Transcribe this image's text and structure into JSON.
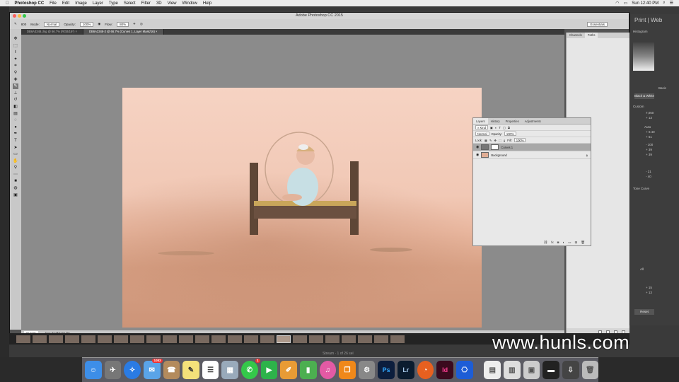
{
  "menubar": {
    "brand": "Photoshop CC",
    "items": [
      "File",
      "Edit",
      "Image",
      "Layer",
      "Type",
      "Select",
      "Filter",
      "3D",
      "View",
      "Window",
      "Help"
    ],
    "time": "Sun 12:40 PM"
  },
  "lightroom": {
    "top_left": "Print",
    "top_right": "Web",
    "histogram_label": "Histogram",
    "basic": "Basic",
    "bw": "Black & White",
    "custom": "Custom",
    "auto": "Auto",
    "tone_curve": "Tone Curve",
    "all": "All",
    "reset": "Reset",
    "values": [
      "7,050",
      "+ 13",
      "+ 0.40",
      "+ 51",
      "- 100",
      "+ 39",
      "+ 39",
      "- 21",
      "- 40",
      "+ 15",
      "+ 13"
    ],
    "filmstrip_label": "Stream · 1 of 26 sel"
  },
  "window": {
    "title": "Adobe Photoshop CC 2015",
    "lr_title": "Lightroom Catalog.lrcat - Adobe Photoshop Lightroom - Develop"
  },
  "options": {
    "mode_label": "Mode:",
    "mode_value": "Normal",
    "opacity_label": "Opacity:",
    "opacity_value": "100%",
    "flow_label": "Flow:",
    "flow_value": "80%",
    "brush_size": "800",
    "workspace": "Essentials"
  },
  "tabs": [
    {
      "label": "DB6A3348.dng @ 66.7% (RGB/16*) ×"
    },
    {
      "label": "DB6A3348-2 @ 66.7% (Curves 1, Layer Mask/16) ×"
    }
  ],
  "status": {
    "zoom": "66.67%",
    "doc": "Doc: 83.9M/176.3M"
  },
  "right_panel": {
    "tabs": [
      "Channels",
      "Paths"
    ]
  },
  "layers_panel": {
    "tabs": [
      "Layers",
      "History",
      "Properties",
      "Adjustments"
    ],
    "kind": "Kind",
    "blend": "Normal",
    "opacity_label": "Opacity:",
    "opacity": "100%",
    "lock_label": "Lock:",
    "fill_label": "Fill:",
    "fill": "100%",
    "layers": [
      {
        "name": "Curves 1"
      },
      {
        "name": "Background"
      }
    ],
    "footer": "fx"
  },
  "dock": {
    "mail_badge": "1083",
    "messages_badge": "1",
    "apps": [
      "Finder",
      "Launchpad",
      "Safari",
      "Mail",
      "Contacts",
      "Notes",
      "Reminders",
      "Preview",
      "Messages",
      "FaceTime",
      "Pages",
      "Numbers",
      "iTunes",
      "iBooks",
      "System Preferences",
      "Photoshop",
      "Lightroom",
      "Firefox",
      "InDesign",
      "Capture",
      "Documents",
      "Files",
      "Preview2",
      "Terminal",
      "Downloads",
      "Trash"
    ],
    "ps_label": "Ps",
    "lr_label": "Lr",
    "id_label": "Id"
  },
  "watermark": "www.hunls.com"
}
